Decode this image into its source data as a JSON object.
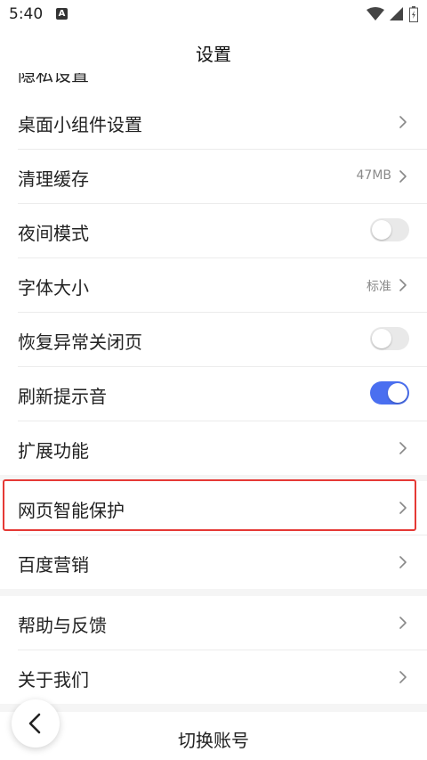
{
  "status_bar": {
    "time": "5:40",
    "notif_icon_letter": "A"
  },
  "header": {
    "title": "设置"
  },
  "partial_row": {
    "label": "隐私设置"
  },
  "group1": [
    {
      "label": "桌面小组件设置",
      "kind": "chevron"
    },
    {
      "label": "清理缓存",
      "kind": "chevron",
      "value": "47MB"
    },
    {
      "label": "夜间模式",
      "kind": "toggle",
      "on": false
    },
    {
      "label": "字体大小",
      "kind": "chevron",
      "value": "标准"
    },
    {
      "label": "恢复异常关闭页",
      "kind": "toggle",
      "on": false
    },
    {
      "label": "刷新提示音",
      "kind": "toggle",
      "on": true
    },
    {
      "label": "扩展功能",
      "kind": "chevron"
    }
  ],
  "group2": [
    {
      "label": "网页智能保护",
      "kind": "chevron",
      "highlighted": true
    },
    {
      "label": "百度营销",
      "kind": "chevron"
    }
  ],
  "group3": [
    {
      "label": "帮助与反馈",
      "kind": "chevron"
    },
    {
      "label": "关于我们",
      "kind": "chevron"
    }
  ],
  "bottom": {
    "switch_account": "切换账号"
  },
  "colors": {
    "accent": "#4a6ff0",
    "highlight": "#e53935"
  }
}
